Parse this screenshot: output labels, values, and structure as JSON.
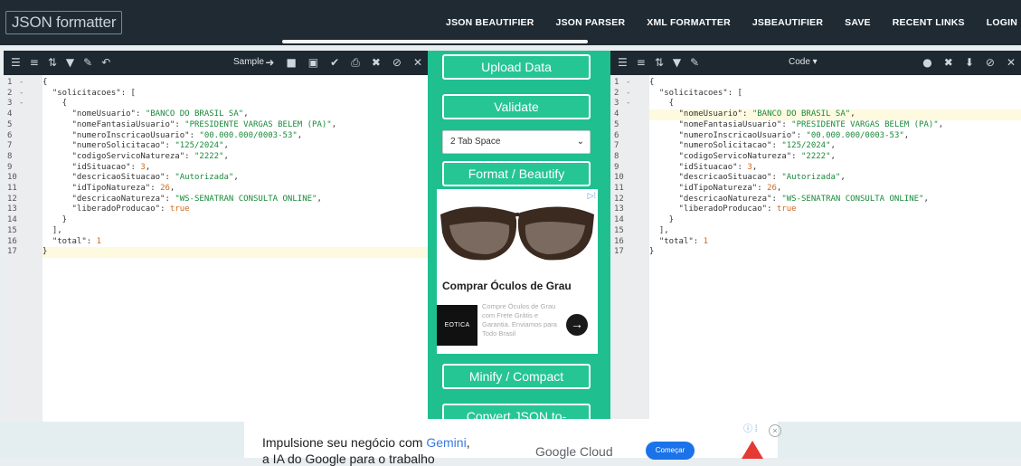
{
  "header": {
    "logo": "JSON formatter",
    "nav": [
      "JSON BEAUTIFIER",
      "JSON PARSER",
      "XML FORMATTER",
      "JSBEAUTIFIER",
      "SAVE",
      "RECENT LINKS",
      "LOGIN"
    ]
  },
  "left_editor": {
    "toolbar_label": "Sample",
    "lines": [
      {
        "n": "1",
        "fold": "-",
        "html": "{"
      },
      {
        "n": "2",
        "fold": "-",
        "html": "  <span class=\"k\">\"solicitacoes\"</span>: ["
      },
      {
        "n": "3",
        "fold": "-",
        "html": "    {"
      },
      {
        "n": "4",
        "fold": "",
        "html": "      <span class=\"k\">\"nomeUsuario\"</span>: <span class=\"s\">\"BANCO DO BRASIL SA\"</span>,"
      },
      {
        "n": "5",
        "fold": "",
        "html": "      <span class=\"k\">\"nomeFantasiaUsuario\"</span>: <span class=\"s\">\"PRESIDENTE VARGAS BELEM (PA)\"</span>,"
      },
      {
        "n": "6",
        "fold": "",
        "html": "      <span class=\"k\">\"numeroInscricaoUsuario\"</span>: <span class=\"s\">\"00.000.000/0003-53\"</span>,"
      },
      {
        "n": "7",
        "fold": "",
        "html": "      <span class=\"k\">\"numeroSolicitacao\"</span>: <span class=\"s\">\"125/2024\"</span>,"
      },
      {
        "n": "8",
        "fold": "",
        "html": "      <span class=\"k\">\"codigoServicoNatureza\"</span>: <span class=\"s\">\"2222\"</span>,"
      },
      {
        "n": "9",
        "fold": "",
        "html": "      <span class=\"k\">\"idSituacao\"</span>: <span class=\"n\">3</span>,"
      },
      {
        "n": "10",
        "fold": "",
        "html": "      <span class=\"k\">\"descricaoSituacao\"</span>: <span class=\"s\">\"Autorizada\"</span>,"
      },
      {
        "n": "11",
        "fold": "",
        "html": "      <span class=\"k\">\"idTipoNatureza\"</span>: <span class=\"n\">26</span>,"
      },
      {
        "n": "12",
        "fold": "",
        "html": "      <span class=\"k\">\"descricaoNatureza\"</span>: <span class=\"s\">\"WS-SENATRAN CONSULTA ONLINE\"</span>,"
      },
      {
        "n": "13",
        "fold": "",
        "html": "      <span class=\"k\">\"liberadoProducao\"</span>: <span class=\"b\">true</span>"
      },
      {
        "n": "14",
        "fold": "",
        "html": "    }"
      },
      {
        "n": "15",
        "fold": "",
        "html": "  ],"
      },
      {
        "n": "16",
        "fold": "",
        "html": "  <span class=\"k\">\"total\"</span>: <span class=\"n\">1</span>"
      },
      {
        "n": "17",
        "fold": "",
        "html": "}"
      }
    ],
    "highlight_line": 17
  },
  "right_editor": {
    "toolbar_label": "Code",
    "lines": [
      {
        "n": "1",
        "fold": "-",
        "html": "{"
      },
      {
        "n": "2",
        "fold": "-",
        "html": "  <span class=\"k\">\"solicitacoes\"</span>: ["
      },
      {
        "n": "3",
        "fold": "-",
        "html": "    {"
      },
      {
        "n": "4",
        "fold": "",
        "html": "      <span class=\"k\">\"nomeUsuario\"</span>: <span class=\"s\">\"BANCO DO BRASIL SA\"</span>,"
      },
      {
        "n": "5",
        "fold": "",
        "html": "      <span class=\"k\">\"nomeFantasiaUsuario\"</span>: <span class=\"s\">\"PRESIDENTE VARGAS BELEM (PA)\"</span>,"
      },
      {
        "n": "6",
        "fold": "",
        "html": "      <span class=\"k\">\"numeroInscricaoUsuario\"</span>: <span class=\"s\">\"00.000.000/0003-53\"</span>,"
      },
      {
        "n": "7",
        "fold": "",
        "html": "      <span class=\"k\">\"numeroSolicitacao\"</span>: <span class=\"s\">\"125/2024\"</span>,"
      },
      {
        "n": "8",
        "fold": "",
        "html": "      <span class=\"k\">\"codigoServicoNatureza\"</span>: <span class=\"s\">\"2222\"</span>,"
      },
      {
        "n": "9",
        "fold": "",
        "html": "      <span class=\"k\">\"idSituacao\"</span>: <span class=\"n\">3</span>,"
      },
      {
        "n": "10",
        "fold": "",
        "html": "      <span class=\"k\">\"descricaoSituacao\"</span>: <span class=\"s\">\"Autorizada\"</span>,"
      },
      {
        "n": "11",
        "fold": "",
        "html": "      <span class=\"k\">\"idTipoNatureza\"</span>: <span class=\"n\">26</span>,"
      },
      {
        "n": "12",
        "fold": "",
        "html": "      <span class=\"k\">\"descricaoNatureza\"</span>: <span class=\"s\">\"WS-SENATRAN CONSULTA ONLINE\"</span>,"
      },
      {
        "n": "13",
        "fold": "",
        "html": "      <span class=\"k\">\"liberadoProducao\"</span>: <span class=\"b\">true</span>"
      },
      {
        "n": "14",
        "fold": "",
        "html": "    }"
      },
      {
        "n": "15",
        "fold": "",
        "html": "  ],"
      },
      {
        "n": "16",
        "fold": "",
        "html": "  <span class=\"k\">\"total\"</span>: <span class=\"n\">1</span>"
      },
      {
        "n": "17",
        "fold": "",
        "html": "}"
      }
    ],
    "highlight_line": 4
  },
  "middle": {
    "upload_label": "Upload Data",
    "validate_label": "Validate",
    "indent_value": "2 Tab Space",
    "format_label": "Format / Beautify",
    "minify_label": "Minify / Compact",
    "convert_label": "Convert JSON to-"
  },
  "side_ad": {
    "title": "Comprar Óculos de Grau",
    "desc": "Compre Óculos de Grau com Frete Grátis e Garantia. Enviamos para Todo Brasil",
    "logo_text": "EOTICA",
    "arrow": "→"
  },
  "bottom_ad": {
    "text_before": "Impulsione seu negócio com ",
    "text_gemini": "Gemini",
    "text_after": ",",
    "text_line2": "a IA do Google para o trabalho",
    "brand": "Google Cloud",
    "cta": "Começar",
    "close": "×"
  },
  "colors": {
    "header_bg": "#1f2a33",
    "accent_green": "#1fbf8f",
    "toolbar_bg": "#1e2830",
    "string_green": "#1a8a3a",
    "number_orange": "#d2691e"
  }
}
